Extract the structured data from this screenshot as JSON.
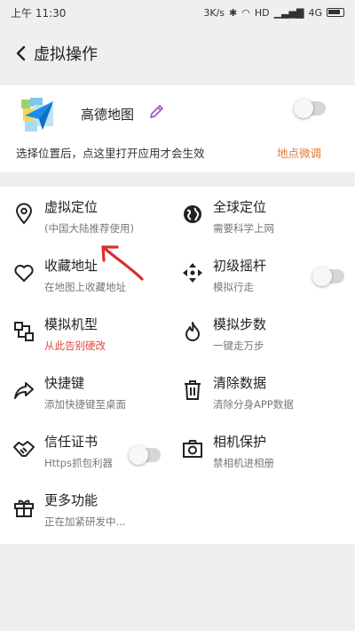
{
  "status": {
    "time": "上午 11:30",
    "speed": "3K/s",
    "hd": "HD",
    "network": "4G"
  },
  "header": {
    "title": "虚拟操作"
  },
  "app": {
    "name": "高德地图",
    "hint": "选择位置后，点这里打开应用才会生效",
    "fine_tune": "地点微调",
    "toggle_on": false
  },
  "features": [
    {
      "title": "虚拟定位",
      "sub": "(中国大陆推荐使用)",
      "icon": "location-pin-icon"
    },
    {
      "title": "全球定位",
      "sub": "需要科学上网",
      "icon": "globe-icon"
    },
    {
      "title": "收藏地址",
      "sub": "在地图上收藏地址",
      "icon": "heart-icon"
    },
    {
      "title": "初级摇杆",
      "sub": "模拟行走",
      "icon": "joystick-arrows-icon",
      "toggle_on": false
    },
    {
      "title": "模拟机型",
      "sub": "从此告别硬改",
      "icon": "device-model-icon"
    },
    {
      "title": "模拟步数",
      "sub": "一键走万步",
      "icon": "flame-icon"
    },
    {
      "title": "快捷键",
      "sub": "添加快捷键至桌面",
      "icon": "share-arrow-icon"
    },
    {
      "title": "清除数据",
      "sub": "清除分身APP数据",
      "icon": "trash-icon"
    },
    {
      "title": "信任证书",
      "sub": "Https抓包利器",
      "icon": "handshake-icon",
      "toggle_on": false
    },
    {
      "title": "相机保护",
      "sub": "禁相机进相册",
      "icon": "camera-icon"
    },
    {
      "title": "更多功能",
      "sub": "正在加紧研发中...",
      "icon": "gift-icon"
    }
  ],
  "colors": {
    "accent_orange": "#e07a3a",
    "warning_red": "#e0463c",
    "annotation_arrow": "#d9302c"
  }
}
